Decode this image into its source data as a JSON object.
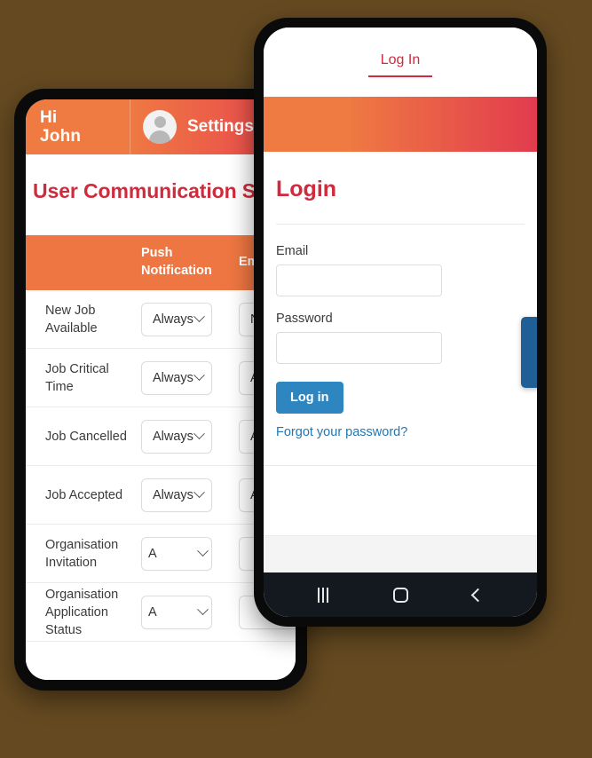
{
  "background_color": "#654A21",
  "left_phone": {
    "header": {
      "greeting_line1": "Hi",
      "greeting_line2": "John",
      "avatar_icon": "user-avatar-icon",
      "account_label": "Settings"
    },
    "page_title": "User Communication Settings",
    "table": {
      "columns": [
        "",
        "Push Notification",
        "Email"
      ],
      "rows": [
        {
          "label": "New Job Available",
          "push": "Always",
          "email": "N",
          "size": "wide"
        },
        {
          "label": "Job Critical Time",
          "push": "Always",
          "email": "A",
          "size": "wide"
        },
        {
          "label": "Job Cancelled",
          "push": "Always",
          "email": "A",
          "size": "wide"
        },
        {
          "label": "Job Accepted",
          "push": "Always",
          "email": "A",
          "size": "wide"
        },
        {
          "label": "Organisation Invitation",
          "push": "A",
          "email": "",
          "size": "narrow"
        },
        {
          "label": "Organisation Application Status",
          "push": "A",
          "email": "",
          "size": "narrow"
        }
      ]
    },
    "colors": {
      "header_gradient_start": "#EF7B42",
      "header_gradient_end": "#E8444E",
      "table_header": "#EE7642",
      "title_red": "#CF2B3C"
    }
  },
  "right_phone": {
    "tab": {
      "label": "Log In"
    },
    "heading": "Login",
    "form": {
      "email_label": "Email",
      "email_value": "",
      "email_placeholder": "",
      "password_label": "Password",
      "password_value": "",
      "password_placeholder": "",
      "submit_label": "Log in",
      "forgot_link": "Forgot your password?"
    },
    "side_button": {
      "name": "floating-side-button",
      "color": "#1F5F96"
    },
    "navbar": {
      "recents_icon": "recents-icon",
      "home_icon": "home-icon",
      "back_icon": "back-icon"
    },
    "colors": {
      "band_gradient_start": "#EF7B42",
      "band_gradient_end": "#E23B4E",
      "heading_red": "#CF2B3C",
      "button_blue": "#2E86C1",
      "link_blue": "#1F77B4"
    }
  }
}
